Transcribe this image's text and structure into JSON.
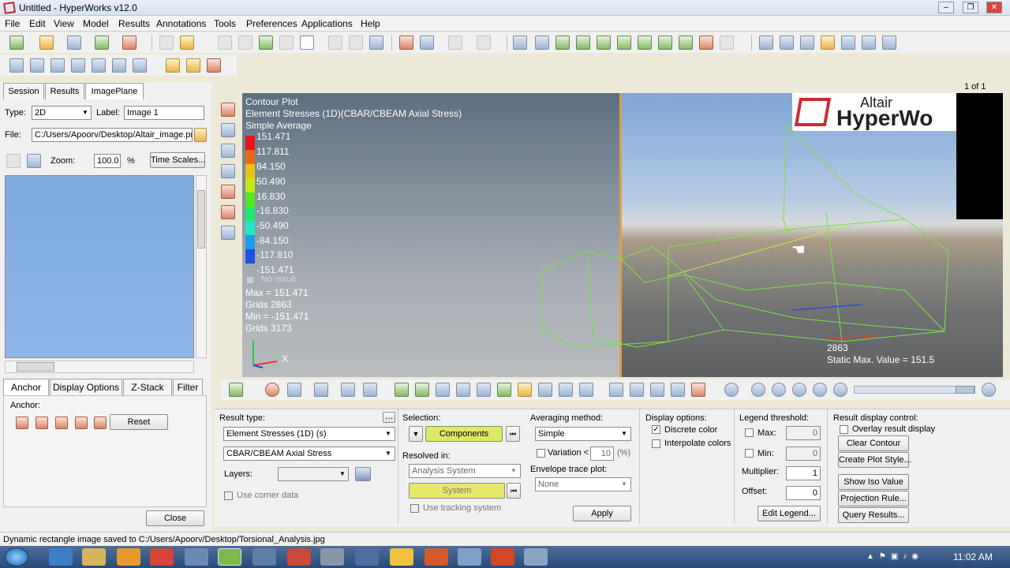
{
  "window": {
    "title": "Untitled - HyperWorks v12.0",
    "controls": [
      "–",
      "❐",
      "✕"
    ]
  },
  "menu": [
    "File",
    "Edit",
    "View",
    "Model",
    "Results",
    "Annotations",
    "Tools",
    "Preferences",
    "Applications",
    "Help"
  ],
  "page_indicator": "1 of 1",
  "left_panel": {
    "tabs": [
      "Session",
      "Results",
      "ImagePlane"
    ],
    "type_label": "Type:",
    "type_value": "2D",
    "label_label": "Label:",
    "label_value": "Image 1",
    "file_label": "File:",
    "file_value": "C:/Users/Apoorv/Desktop/Altair_image.png",
    "zoom_label": "Zoom:",
    "zoom_value": "100.0",
    "zoom_unit": "%",
    "time_scales": "Time Scales...",
    "sub_tabs": [
      "Anchor",
      "Display Options",
      "Z-Stack",
      "Filter"
    ],
    "anchor_label": "Anchor:",
    "reset": "Reset",
    "close": "Close"
  },
  "viewport": {
    "plot_title": "Contour Plot",
    "plot_subtitle": "Element Stresses (1D)(CBAR/CBEAM Axial Stress)",
    "averaging": "Simple Average",
    "legend": [
      "151.471",
      "117.811",
      "84.150",
      "50.490",
      "16.830",
      "-16.830",
      "-50.490",
      "-84.150",
      "-117.810",
      "-151.471"
    ],
    "legend_colors": [
      "#e8141b",
      "#e86a14",
      "#e8c214",
      "#c4e814",
      "#52e820",
      "#1ee86e",
      "#1ee8c8",
      "#1e9ee8",
      "#1e50e8",
      "#1414b0"
    ],
    "no_result": "No result",
    "stats": [
      "Max = 151.471",
      "Grids 2863",
      "Min = -151.471",
      "Grids 3173"
    ],
    "axis_x": "X",
    "brand_top": "Altair",
    "brand_bottom": "HyperWo",
    "node_id": "2863",
    "static_max": "Static Max. Value = 151.5"
  },
  "bottom_panel": {
    "result_type_label": "Result type:",
    "result_type_value": "Element Stresses (1D) (s)",
    "result_sub_value": "CBAR/CBEAM Axial Stress",
    "layers_label": "Layers:",
    "use_corner": "Use corner data",
    "selection_label": "Selection:",
    "components": "Components",
    "resolved_label": "Resolved in:",
    "resolved_value": "Analysis System",
    "system": "System",
    "use_tracking": "Use tracking system",
    "averaging_label": "Averaging method:",
    "averaging_value": "Simple",
    "variation_label": "Variation <",
    "variation_value": "10",
    "variation_unit": "(%)",
    "envelope_label": "Envelope trace plot:",
    "envelope_value": "None",
    "apply": "Apply",
    "display_label": "Display options:",
    "discrete_color": "Discrete color",
    "interpolate_colors": "Interpolate colors",
    "legend_threshold_label": "Legend threshold:",
    "max_label": "Max:",
    "max_value": "0",
    "min_label": "Min:",
    "min_value": "0",
    "multiplier_label": "Multiplier:",
    "multiplier_value": "1",
    "offset_label": "Offset:",
    "offset_value": "0",
    "edit_legend": "Edit Legend...",
    "result_display_label": "Result display control:",
    "overlay": "Overlay result display",
    "clear_contour": "Clear Contour",
    "create_plot_style": "Create Plot Style...",
    "show_iso": "Show Iso Value",
    "projection_rule": "Projection Rule...",
    "query_results": "Query Results..."
  },
  "status": "Dynamic rectangle image saved to C:/Users/Apoorv/Desktop/Torsional_Analysis.jpg",
  "taskbar": {
    "time": "11:02 AM"
  }
}
